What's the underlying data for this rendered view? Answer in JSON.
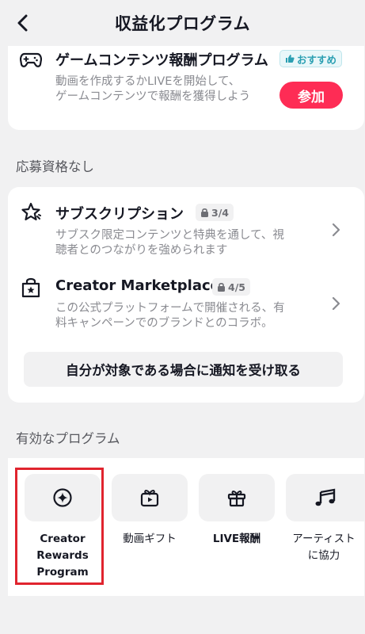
{
  "header": {
    "title": "収益化プログラム"
  },
  "game_program": {
    "title": "ゲームコンテンツ報酬プログラム",
    "badge": "おすすめ",
    "desc_line1": "動画を作成するかLIVEを開始して、",
    "desc_line2": "ゲームコンテンツで報酬を獲得しよう",
    "join_label": "参加"
  },
  "ineligible": {
    "section_label": "応募資格なし",
    "items": [
      {
        "title": "サブスクリプション",
        "progress": "3/4",
        "desc_line1": "サブスク限定コンテンツと特典を通して、視",
        "desc_line2": "聴者とのつながりを強められます"
      },
      {
        "title": "Creator Marketplace",
        "progress": "4/5",
        "desc_line1": "この公式プラットフォームで開催される、有",
        "desc_line2": "料キャンペーンでのブランドとのコラボ。"
      }
    ],
    "notify_label": "自分が対象である場合に通知を受け取る"
  },
  "active": {
    "section_label": "有効なプログラム",
    "programs": [
      {
        "line1": "Creator",
        "line2": "Rewards",
        "line3": "Program"
      },
      {
        "line1": "動画ギフト"
      },
      {
        "line1": "LIVE報酬"
      },
      {
        "line1": "アーティスト",
        "line2": "に協力"
      }
    ]
  },
  "colors": {
    "accent": "#fe2c55",
    "highlight": "#e0242e",
    "recommend": "#2a9fb2"
  }
}
